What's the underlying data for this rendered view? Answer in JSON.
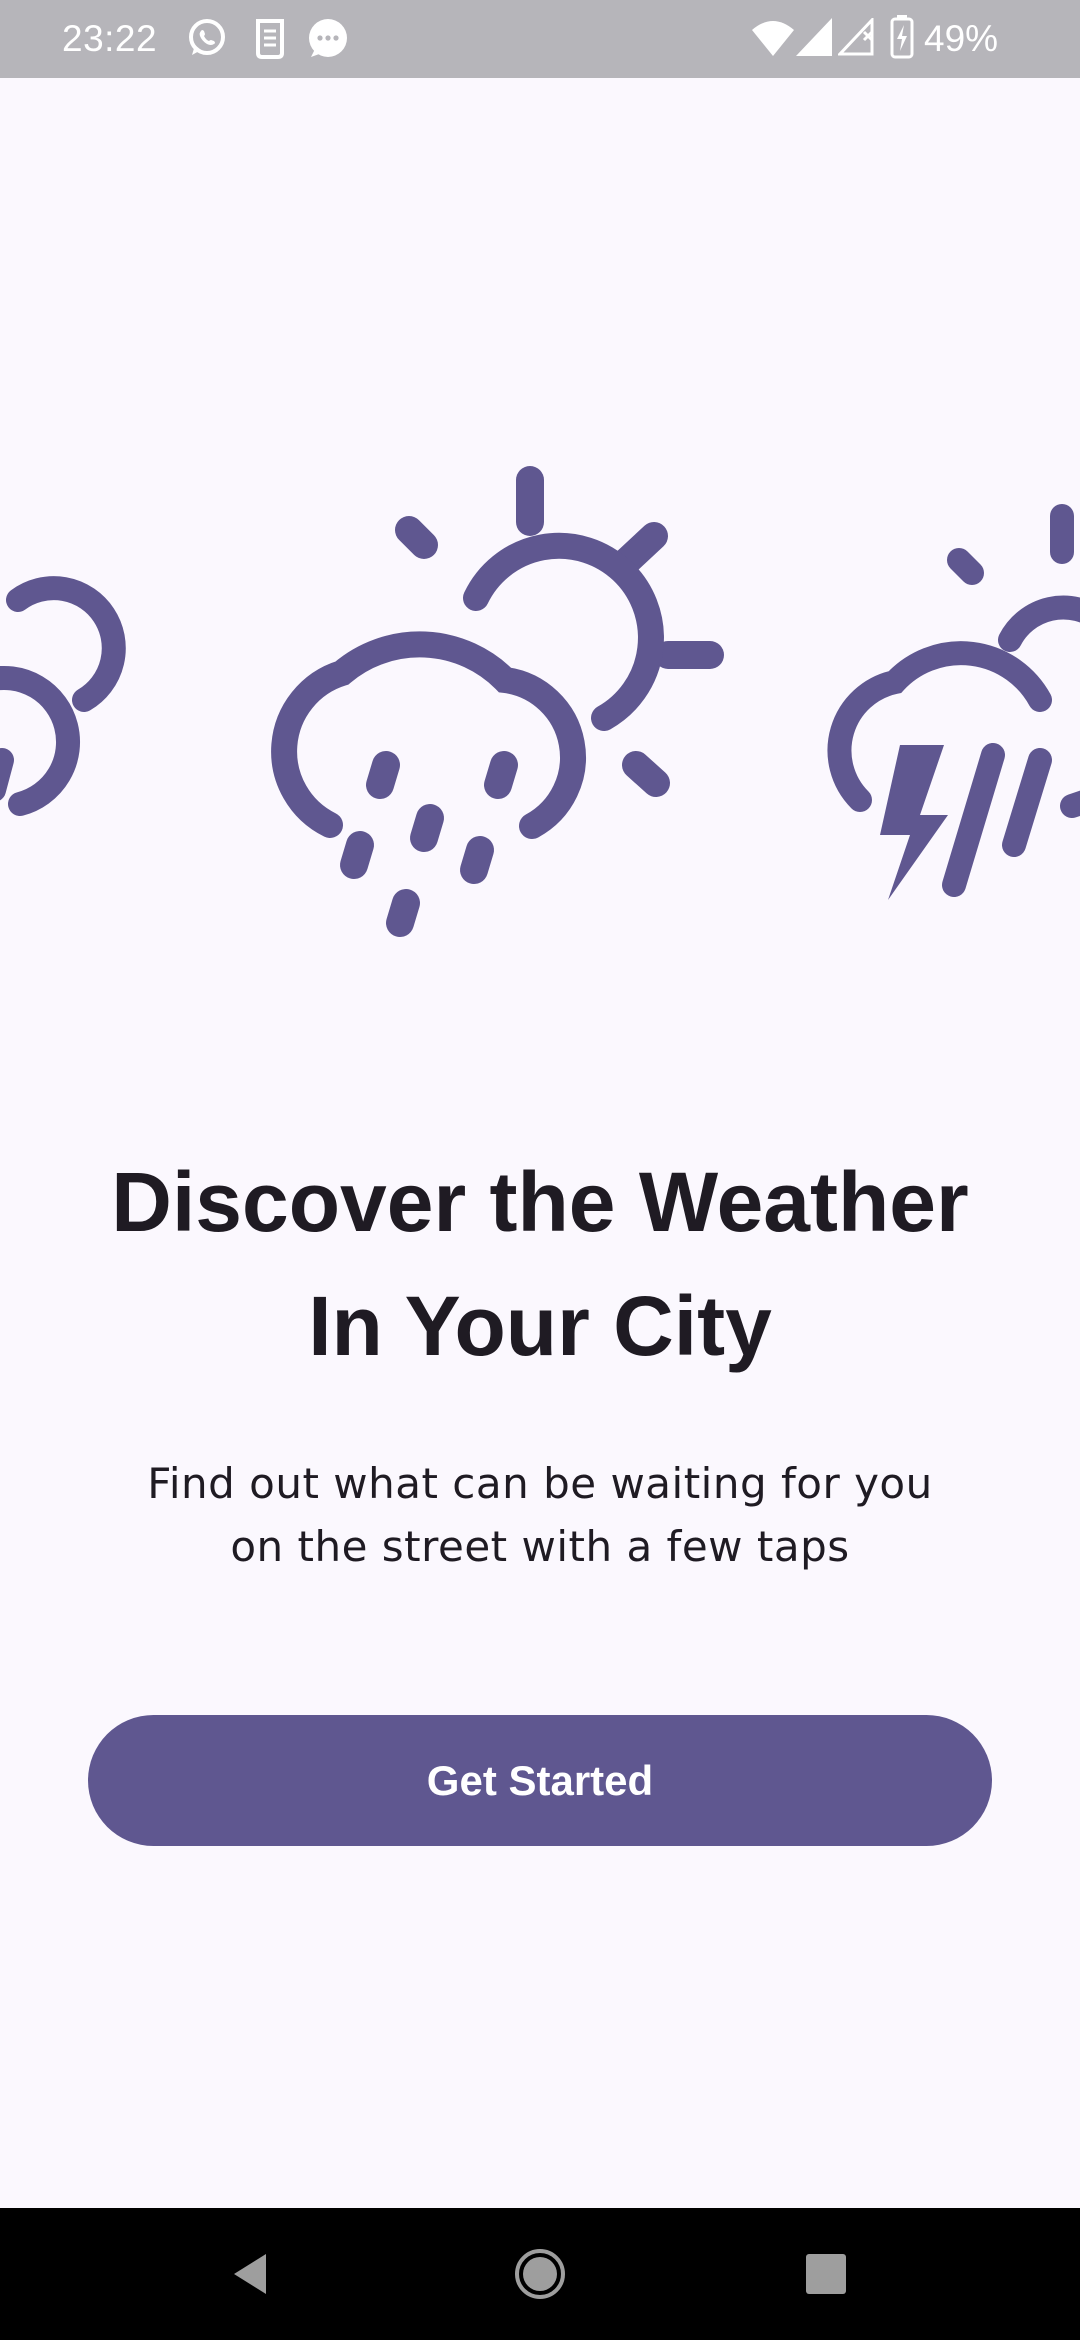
{
  "status_bar": {
    "time": "23:22",
    "battery": "49%",
    "left_icons": [
      "whatsapp-icon",
      "sim-toolkit-icon",
      "messages-icon"
    ],
    "right_icons": [
      "wifi-icon",
      "signal-icon",
      "signal-no-sim-icon",
      "battery-charging-icon"
    ]
  },
  "illustration": {
    "icons": [
      "cloud-sun-icon",
      "cloud-sun-rain-icon",
      "cloud-sun-thunderstorm-icon"
    ],
    "color": "#5f5790"
  },
  "onboarding": {
    "title_line1": "Discover the Weather",
    "title_line2": "In Your City",
    "subtitle_line1": "Find out what can be waiting for you",
    "subtitle_line2": "on the street with a few taps",
    "button_label": "Get Started"
  },
  "colors": {
    "background": "#fbf8fe",
    "accent": "#5f5790",
    "text": "#1f1b23",
    "status_bar": "#b6b5ba"
  },
  "navigation": {
    "buttons": [
      "back-icon",
      "home-icon",
      "recents-icon"
    ]
  }
}
